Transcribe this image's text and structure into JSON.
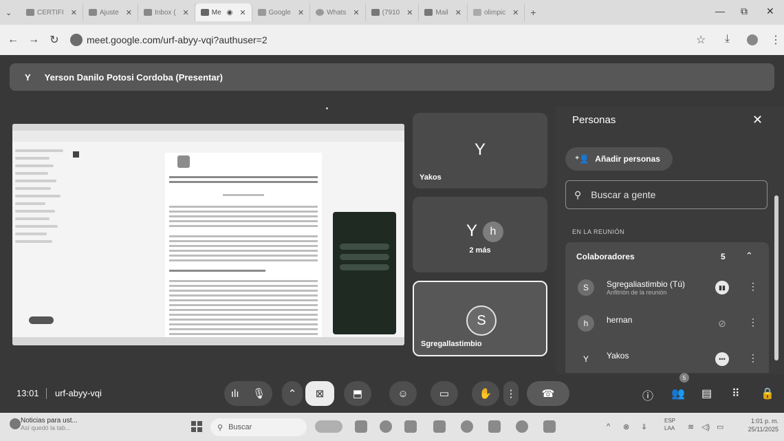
{
  "browser": {
    "tabs": [
      {
        "label": "CERTIFI",
        "favicon": "gmail-icon"
      },
      {
        "label": "Ajuste",
        "favicon": "gmail-icon"
      },
      {
        "label": "Inbox (",
        "favicon": "gmail-icon"
      },
      {
        "label": "Me",
        "favicon": "meet-icon"
      },
      {
        "label": "Google",
        "favicon": "meet-icon"
      },
      {
        "label": "Whats",
        "favicon": "whatsapp-icon"
      },
      {
        "label": "(7910",
        "favicon": "mail-icon"
      },
      {
        "label": "Mail",
        "favicon": "mail-icon"
      },
      {
        "label": "olimpic",
        "favicon": "app-icon"
      }
    ],
    "url": "meet.google.com/urf-abyy-vqi?authuser=2"
  },
  "meet": {
    "presenter_initial": "Y",
    "presenter_label": "Yerson Danilo Potosi Cordoba (Presentar)",
    "tiles": {
      "yakos": {
        "letter": "Y",
        "name": "Yakos"
      },
      "more": {
        "av1": "Y",
        "av2": "h",
        "label": "2 más"
      },
      "self": {
        "letter": "S",
        "name": "Sgregallastimbio"
      }
    },
    "people_panel": {
      "title": "Personas",
      "add_label": "Añadir personas",
      "search_placeholder": "Buscar a gente",
      "section_label": "EN LA REUNIÓN",
      "group_label": "Colaboradores",
      "group_count": "5",
      "people": [
        {
          "initial": "S",
          "name": "Sgregaliastimbio (Tú)",
          "role": "Anfitrión de la reunión",
          "status": "speaking"
        },
        {
          "initial": "h",
          "name": "hernan",
          "role": "",
          "status": "muted"
        },
        {
          "initial": "Y",
          "name": "Yakos",
          "role": "",
          "status": "more"
        }
      ]
    },
    "bottom": {
      "time": "13:01",
      "code": "urf-abyy-vqi",
      "people_badge": "5"
    }
  },
  "taskbar": {
    "news_title": "Noticias para ust...",
    "news_sub": "Así quedó la tab...",
    "search": "Buscar",
    "lang1": "ESP",
    "lang2": "LAA",
    "time": "1:01 p. m.",
    "date": "25/11/2025"
  }
}
